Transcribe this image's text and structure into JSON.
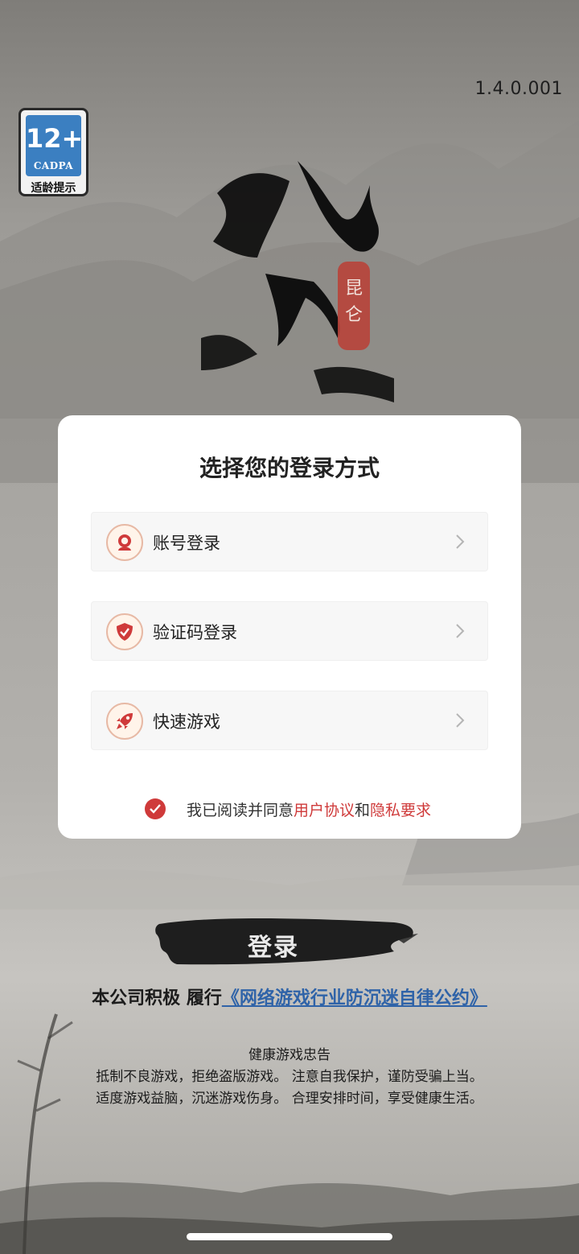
{
  "version": "1.4.0.001",
  "age_rating": {
    "age": "12+",
    "org": "CADPA",
    "tip": "适龄提示"
  },
  "logo": {
    "title": "九州江",
    "seal": "昆仑"
  },
  "modal": {
    "title": "选择您的登录方式",
    "options": [
      {
        "label": "账号登录",
        "icon": "user-icon"
      },
      {
        "label": "验证码登录",
        "icon": "shield-check-icon"
      },
      {
        "label": "快速游戏",
        "icon": "rocket-icon"
      }
    ],
    "agreement": {
      "prefix": "我已阅读并同意",
      "user_agreement": "用户协议",
      "and": "和",
      "privacy": "隐私要求",
      "checked": true
    }
  },
  "login_button": "登录",
  "pact": {
    "prefix": "本公司积极  履行",
    "link": "《网络游戏行业防沉迷自律公约》"
  },
  "health_advice": {
    "title": "健康游戏忠告",
    "line1": "抵制不良游戏，拒绝盗版游戏。 注意自我保护，谨防受骗上当。",
    "line2": "适度游戏益脑，沉迷游戏伤身。 合理安排时间，享受健康生活。"
  },
  "colors": {
    "accent": "#cf3a3a",
    "link_blue": "#2f63a8",
    "age_blue": "#3b7fc1"
  }
}
